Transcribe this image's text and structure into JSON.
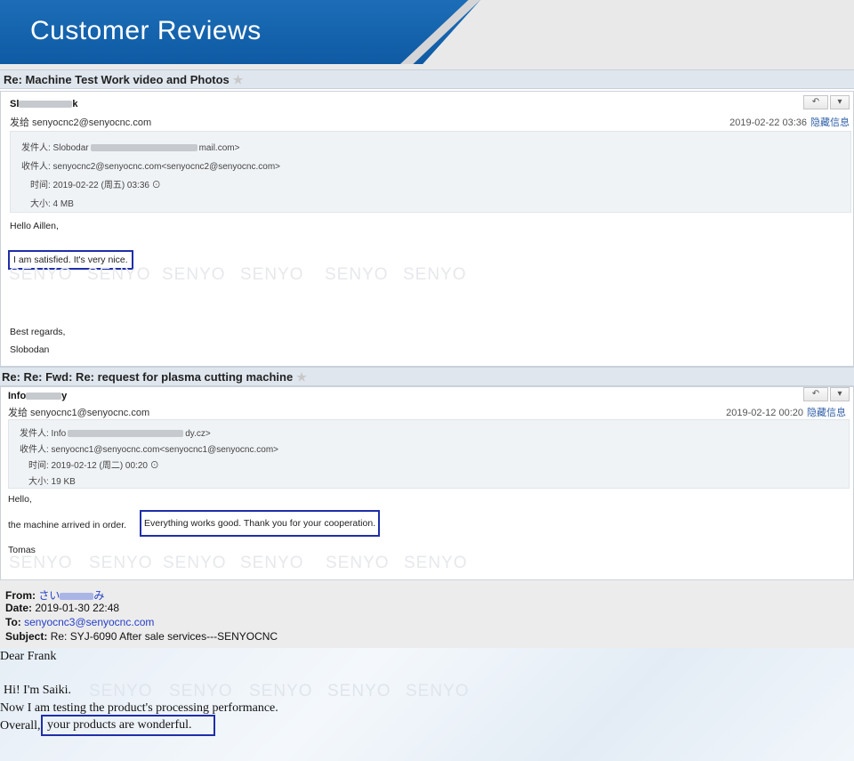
{
  "banner": {
    "title": "Customer  Reviews"
  },
  "email1": {
    "subject": "Re: Machine Test Work video and Photos",
    "sender": "Sl",
    "sender_tail": "k",
    "from_line": "发给 senyocnc2@senyocnc.com",
    "date": "2019-02-22 03:36",
    "hide_link": "隐藏信息",
    "meta": {
      "from_prefix": "发件人: Slobodar",
      "from_suffix": "mail.com>",
      "to": "收件人: senyocnc2@senyocnc.com<senyocnc2@senyocnc.com>",
      "time": "时间: 2019-02-22 (周五) 03:36",
      "size": "大小: 4 MB"
    },
    "greeting": "Hello Aillen,",
    "highlight": "I am satisfied. It's very nice.",
    "closing": "Best regards,",
    "signature": "Slobodan"
  },
  "email2": {
    "subject": "Re: Re: Fwd: Re: request for plasma cutting machine",
    "sender": "Info",
    "sender_tail": "y",
    "from_line": "发给 senyocnc1@senyocnc.com",
    "date": "2019-02-12 00:20",
    "hide_link": "隐藏信息",
    "meta": {
      "from_prefix": "发件人: Info",
      "from_suffix": "dy.cz>",
      "to": "收件人: senyocnc1@senyocnc.com<senyocnc1@senyocnc.com>",
      "time": "时间: 2019-02-12 (周二) 00:20",
      "size": "大小: 19 KB"
    },
    "greeting": "Hello,",
    "line_prefix": "the machine arrived in order.",
    "highlight": "Everything works good. Thank you for your cooperation.",
    "signature": "Tomas"
  },
  "email3": {
    "from_label": "From:",
    "from_value": "さい",
    "from_value_tail": "み",
    "date_label": "Date:",
    "date_value": "2019-01-30 22:48",
    "to_label": "To:",
    "to_value": "senyocnc3@senyocnc.com",
    "subject_label": "Subject:",
    "subject_value": "Re: SYJ-6090 After sale services---SENYOCNC",
    "greeting": "Dear Frank",
    "line1": "Hi! I'm Saiki.",
    "line2": "Now I am testing the product's processing performance.",
    "line3_prefix": "Overall,",
    "highlight": "your products are wonderful."
  },
  "watermark": "SENYO",
  "buttons": {
    "reply": "↶",
    "more": "▾"
  },
  "colors": {
    "banner_blue": "#1464b0",
    "highlight_border": "#1f2fa8",
    "link": "#3160a8"
  }
}
